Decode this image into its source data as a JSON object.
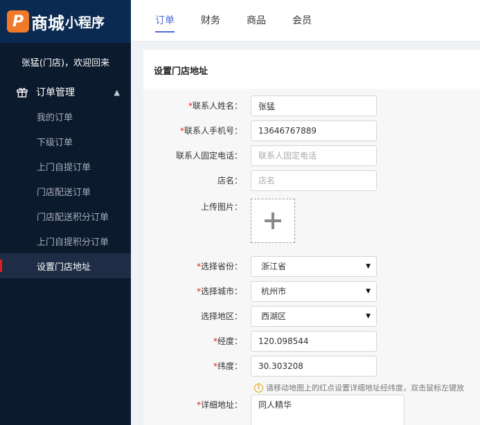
{
  "logo": {
    "mark": "P",
    "big": "商城",
    "small": "小程序"
  },
  "sidebar": {
    "welcome": "张猛(门店)，欢迎回来",
    "group": {
      "label": "订单管理",
      "icon": "gift-icon"
    },
    "items": [
      {
        "label": "我的订单"
      },
      {
        "label": "下级订单"
      },
      {
        "label": "上门自提订单"
      },
      {
        "label": "门店配送订单"
      },
      {
        "label": "门店配送积分订单"
      },
      {
        "label": "上门自提积分订单"
      },
      {
        "label": "设置门店地址",
        "active": true
      }
    ]
  },
  "tabs": [
    {
      "label": "订单",
      "active": true
    },
    {
      "label": "财务"
    },
    {
      "label": "商品"
    },
    {
      "label": "会员"
    }
  ],
  "panel": {
    "title": "设置门店地址"
  },
  "form": {
    "contact_name": {
      "label": "联系人姓名：",
      "value": "张猛",
      "required": true
    },
    "contact_mobile": {
      "label": "联系人手机号：",
      "value": "13646767889",
      "required": true
    },
    "contact_phone": {
      "label": "联系人固定电话：",
      "placeholder": "联系人固定电话"
    },
    "store_name": {
      "label": "店名：",
      "placeholder": "店名"
    },
    "upload": {
      "label": "上传图片："
    },
    "province": {
      "label": "选择省份：",
      "value": "浙江省",
      "required": true
    },
    "city": {
      "label": "选择城市：",
      "value": "杭州市",
      "required": true
    },
    "district": {
      "label": "选择地区：",
      "value": "西湖区"
    },
    "longitude": {
      "label": "经度：",
      "value": "120.098544",
      "required": true
    },
    "latitude": {
      "label": "纬度：",
      "value": "30.303208",
      "required": true
    },
    "hint": "请移动地图上的红点设置详细地址经纬度，双击鼠标左键放",
    "address": {
      "label": "详细地址：",
      "value": "同人精华",
      "required": true
    }
  },
  "colors": {
    "accent": "#4d6dd8",
    "sidebar_bg": "#0c1a2e",
    "required": "#e02020"
  }
}
